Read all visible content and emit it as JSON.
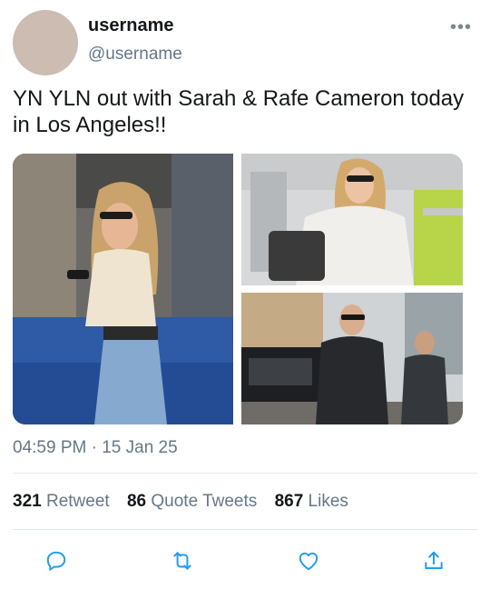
{
  "user": {
    "display_name": "username",
    "handle": "@username",
    "avatar_color": "#cdbcb2"
  },
  "tweet": {
    "text": "YN YLN out with Sarah & Rafe Cameron today in Los Angeles!!",
    "timestamp": "04:59 PM · 15 Jan 25",
    "media": [
      {
        "icon": "photo-woman-on-phone"
      },
      {
        "icon": "photo-woman-with-bag"
      },
      {
        "icon": "photo-men-in-leather-jackets"
      }
    ]
  },
  "stats": {
    "retweets_count": "321",
    "retweets_label": "Retweet",
    "quotes_count": "86",
    "quotes_label": "Quote Tweets",
    "likes_count": "867",
    "likes_label": "Likes"
  },
  "actions": [
    {
      "icon": "reply-icon"
    },
    {
      "icon": "retweet-icon"
    },
    {
      "icon": "like-icon"
    },
    {
      "icon": "share-icon"
    }
  ],
  "colors": {
    "text": "#14171a",
    "secondary": "#657786",
    "divider": "#e1e8ed",
    "action_icon": "#1d9bf0"
  }
}
